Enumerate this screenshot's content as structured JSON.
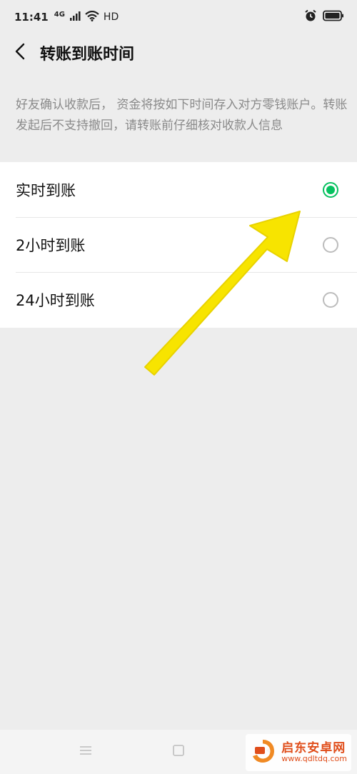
{
  "status_bar": {
    "time": "11:41",
    "network": "4G",
    "hd": "HD",
    "icons": [
      "signal-icon",
      "wifi-icon",
      "alarm-icon",
      "battery-icon"
    ]
  },
  "header": {
    "title": "转账到账时间",
    "back_icon": "chevron-left-icon"
  },
  "description": "好友确认收款后， 资金将按如下时间存入对方零钱账户。转账发起后不支持撤回，请转账前仔细核对收款人信息",
  "options": [
    {
      "label": "实时到账",
      "selected": true
    },
    {
      "label": "2小时到账",
      "selected": false
    },
    {
      "label": "24小时到账",
      "selected": false
    }
  ],
  "colors": {
    "accent": "#07c160",
    "background": "#ededed",
    "arrow": "#f7e400"
  },
  "nav_bar": {
    "icons": [
      "menu-icon",
      "home-square-icon",
      "back-triangle-icon"
    ]
  },
  "watermark": {
    "name": "启东安卓网",
    "url": "www.qdltdq.com"
  }
}
